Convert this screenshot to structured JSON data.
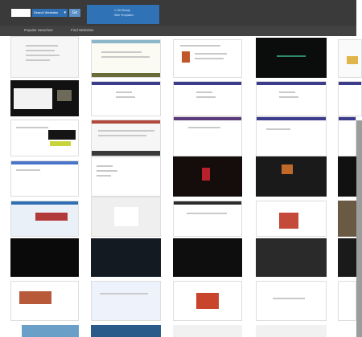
{
  "toolbar": {
    "search_value": "",
    "select_label": "Search Websites",
    "go_label": "Go",
    "promo_line1": "1,750 Ready",
    "promo_line2": "Web Templates"
  },
  "subnav": {
    "link1": "Popular Searches",
    "link2": "Find Websites"
  },
  "colors": {
    "topbar": "#3a3a3a",
    "subbar": "#424242",
    "accent_blue": "#2f73b6"
  }
}
